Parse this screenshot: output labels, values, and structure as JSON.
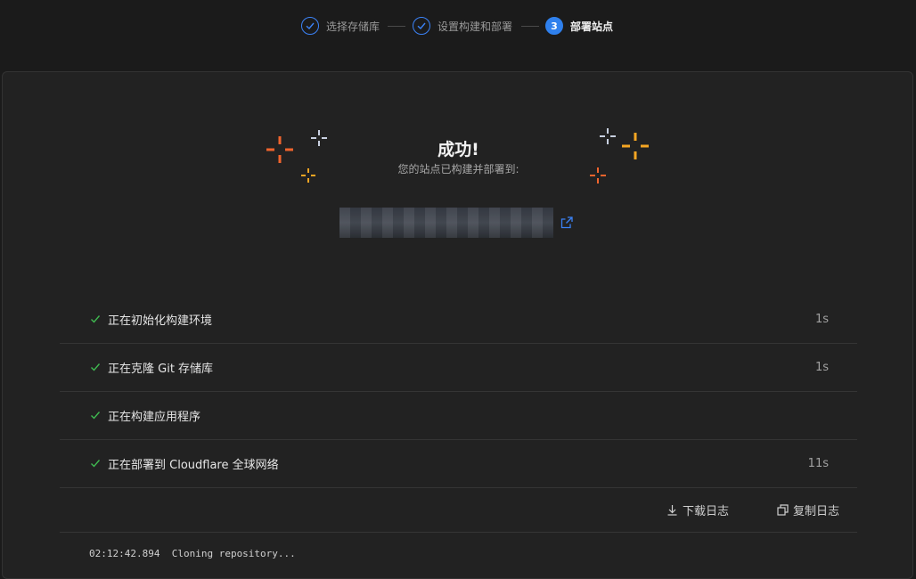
{
  "stepper": {
    "steps": [
      {
        "label": "选择存储库",
        "state": "done"
      },
      {
        "label": "设置构建和部署",
        "state": "done"
      },
      {
        "label": "部署站点",
        "state": "active",
        "number": "3"
      }
    ]
  },
  "result": {
    "title": "成功!",
    "subtitle": "您的站点已构建并部署到:",
    "url_blurred": true
  },
  "steps_log": [
    {
      "label": "正在初始化构建环境",
      "time": "1s"
    },
    {
      "label": "正在克隆 Git 存储库",
      "time": "1s"
    },
    {
      "label": "正在构建应用程序",
      "time": ""
    },
    {
      "label": "正在部署到 Cloudflare 全球网络",
      "time": "11s"
    }
  ],
  "actions": {
    "download_log": "下载日志",
    "copy_log": "复制日志"
  },
  "log_output": {
    "lines": [
      "02:12:42.894  Cloning repository..."
    ]
  },
  "colors": {
    "accent_blue": "#2f80ed",
    "success_green": "#3fb950",
    "spark_orange": "#f0642d",
    "spark_yellow": "#f5a623",
    "spark_white": "#c8d0e0"
  },
  "icons": [
    "check-circle-icon",
    "external-link-icon",
    "check-icon",
    "download-icon",
    "copy-icon",
    "sparkle-icon"
  ]
}
